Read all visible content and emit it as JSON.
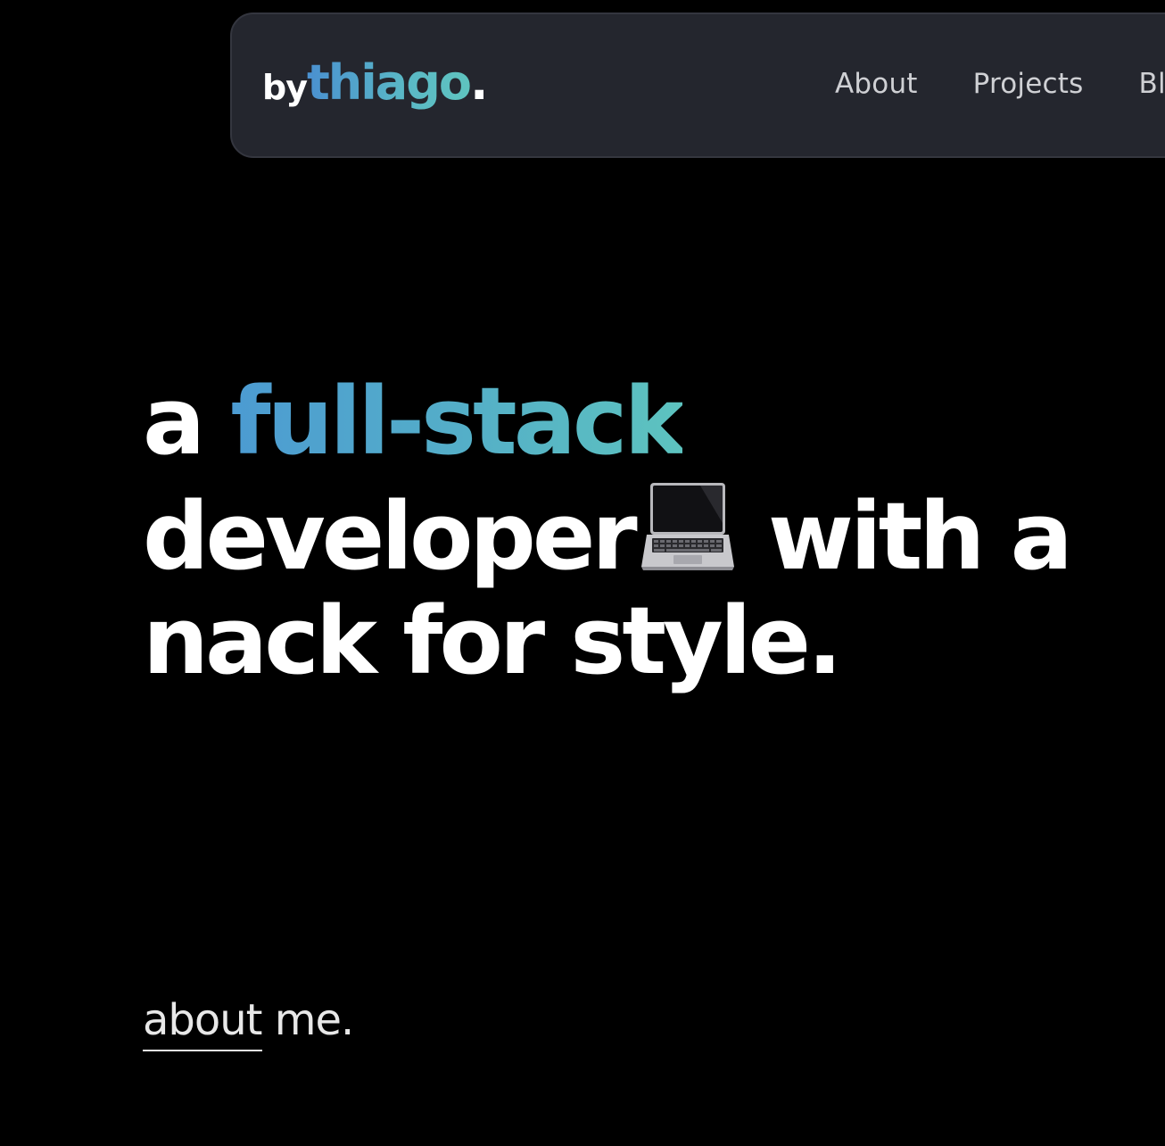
{
  "nav": {
    "logo": {
      "prefix": "by",
      "name": "thiago",
      "suffix": "."
    },
    "links": [
      {
        "label": "About"
      },
      {
        "label": "Projects"
      },
      {
        "label": "Bl"
      }
    ]
  },
  "hero": {
    "line1_prefix": "a ",
    "line1_accent": "full-stack",
    "line2_word": "developer",
    "line2_icon": "laptop-icon",
    "line2_suffix": " with a",
    "line3": "nack for style."
  },
  "about": {
    "link_word": "about",
    "rest": " me."
  },
  "colors": {
    "background": "#000000",
    "navbar": "#24262e",
    "accent_start": "#4a90d0",
    "accent_end": "#5fc4bf",
    "text": "#ffffff"
  }
}
